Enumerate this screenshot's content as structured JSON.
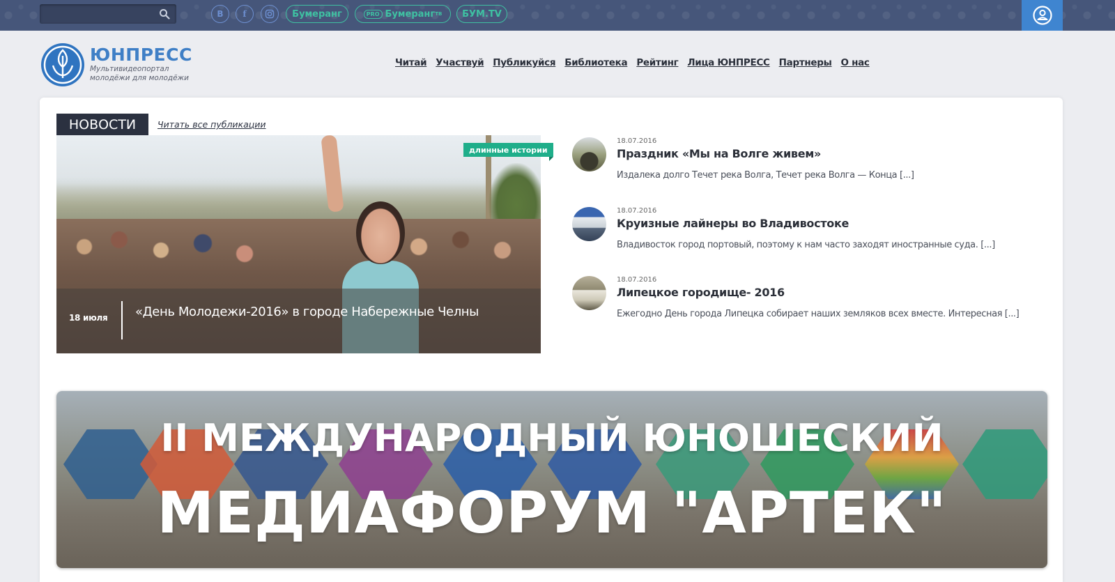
{
  "topbar": {
    "search": {
      "value": "",
      "placeholder": ""
    },
    "social": [
      {
        "label": "В",
        "icon": "vk-icon"
      },
      {
        "label": "f",
        "icon": "facebook-icon"
      },
      {
        "label": "",
        "icon": "instagram-icon"
      }
    ],
    "links": [
      {
        "label": "Бумеранг"
      },
      {
        "pro": "PRO",
        "label": "Бумеранг",
        "sup": "TB"
      },
      {
        "label": "БУМ.TV"
      }
    ],
    "user_icon": "user-icon"
  },
  "header": {
    "logo": {
      "name": "ЮНПРЕСС",
      "tagline_1": "Мультивидеопортал",
      "tagline_2": "молодёжи для молодёжи"
    },
    "nav": [
      "Читай",
      "Участвуй",
      "Публикуйся",
      "Библиотека",
      "Рейтинг",
      "Лица ЮНПРЕСС",
      "Партнеры",
      "О нас"
    ]
  },
  "news": {
    "heading": "НОВОСТИ",
    "all_link": "Читать все публикации",
    "featured": {
      "tag": "длинные истории",
      "date": "18 июля",
      "title": "«День Молодежи-2016» в городе Набережные Челны"
    },
    "items": [
      {
        "date": "18.07.2016",
        "title": "Праздник «Мы на Волге живем»",
        "excerpt": "Издалека долго Течет река Волга, Течет река Волга — Конца [...]"
      },
      {
        "date": "18.07.2016",
        "title": "Круизные лайнеры во Владивостоке",
        "excerpt": "Владивосток город портовый, поэтому к нам часто заходят иностранные суда. [...]"
      },
      {
        "date": "18.07.2016",
        "title": "Липецкое городище- 2016",
        "excerpt": "Ежегодно День города Липецка собирает наших земляков всех вместе. Интересная [...]"
      }
    ]
  },
  "banner": {
    "line1": "II МЕЖДУНАРОДНЫЙ ЮНОШЕСКИЙ",
    "line2": "МЕДИАФОРУМ \"АРТЕК\""
  },
  "colors": {
    "topbar": "#46567a",
    "accent_blue": "#3f85d0",
    "accent_green": "#3fc1a2",
    "social_blue": "#6d8fd0",
    "tag_green": "#1fae8a",
    "heading_dark": "#2b3140"
  }
}
